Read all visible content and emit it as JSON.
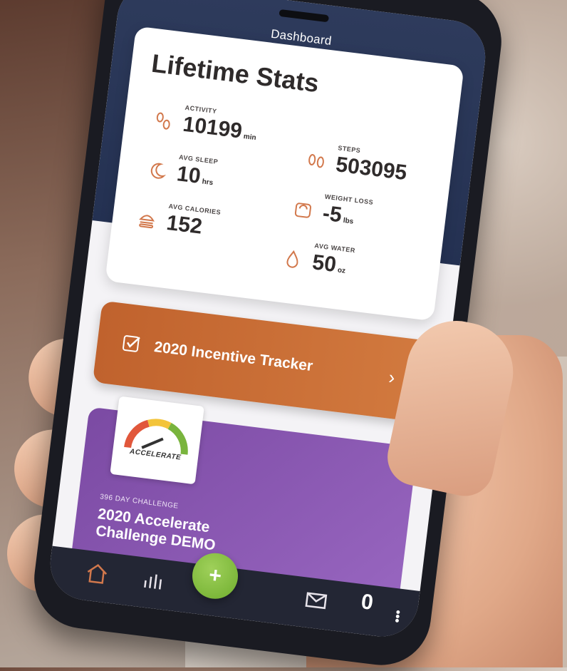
{
  "header": {
    "title": "Dashboard"
  },
  "stats": {
    "title": "Lifetime Stats",
    "activity": {
      "label": "ACTIVITY",
      "value": "10199",
      "unit": "min"
    },
    "steps": {
      "label": "STEPS",
      "value": "503095"
    },
    "avg_sleep": {
      "label": "AVG SLEEP",
      "value": "10",
      "unit": "hrs"
    },
    "weight_loss": {
      "label": "WEIGHT LOSS",
      "value": "-5",
      "unit": "lbs"
    },
    "avg_calories": {
      "label": "AVG CALORIES",
      "value": "152"
    },
    "avg_water": {
      "label": "AVG WATER",
      "value": "50",
      "unit": "oz"
    }
  },
  "tracker": {
    "label": "2020 Incentive Tracker"
  },
  "challenge": {
    "logo_text": "ACCELERATE",
    "subtitle": "396 DAY CHALLENGE",
    "title": "2020 Accelerate Challenge DEMO",
    "count": "0"
  },
  "tabbar": {
    "fab_label": "+"
  },
  "colors": {
    "accent": "#d2784c",
    "tracker": "#c0622d",
    "challenge": "#7b4aa3",
    "fab": "#7fbd3a"
  },
  "icons": {
    "activity": "footprints-icon",
    "steps": "shoe-prints-icon",
    "sleep": "moon-icon",
    "weight": "scale-icon",
    "calories": "burger-icon",
    "water": "droplet-icon"
  }
}
